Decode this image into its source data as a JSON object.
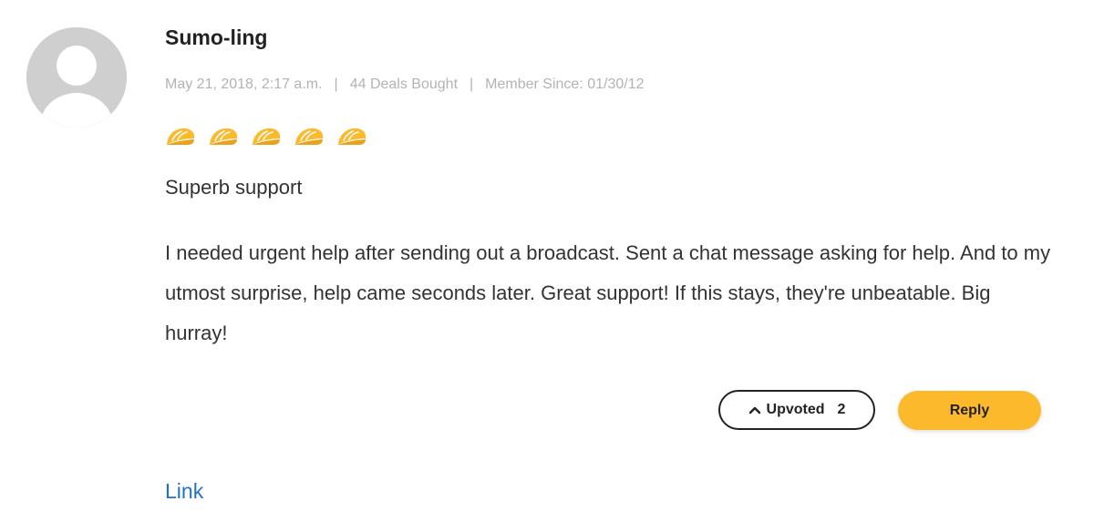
{
  "review": {
    "username": "Sumo-ling",
    "meta": {
      "date": "May 21, 2018, 2:17 a.m.",
      "deals_bought": "44 Deals Bought",
      "member_since": "Member Since: 01/30/12",
      "separator": "|"
    },
    "rating": {
      "value": 5,
      "max": 5,
      "icon": "taco-icon",
      "color": "#fdb92c"
    },
    "title": "Superb support",
    "body": "I needed urgent help after sending out a broadcast. Sent a chat message asking for help. And to my utmost surprise, help came seconds later. Great support! If this stays, they're unbeatable. Big hurray!"
  },
  "actions": {
    "upvote_label": "Upvoted",
    "upvote_count": "2",
    "reply_label": "Reply"
  },
  "footer": {
    "link_label": "Link"
  },
  "colors": {
    "accent": "#fdb92c",
    "link": "#1f73c7",
    "meta_text": "#b3b3b3"
  }
}
